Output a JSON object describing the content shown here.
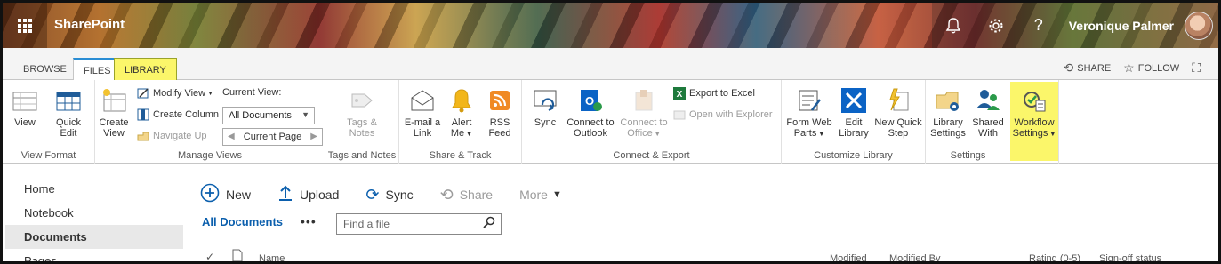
{
  "suite": {
    "app_title": "SharePoint",
    "user_name": "Veronique Palmer",
    "icons": [
      "waffle-icon",
      "bell-icon",
      "gear-icon",
      "help-icon"
    ]
  },
  "tabs": {
    "browse": "BROWSE",
    "files": "FILES",
    "library": "LIBRARY",
    "share": "SHARE",
    "follow": "FOLLOW"
  },
  "ribbon": {
    "view_format": {
      "label": "View Format",
      "view": "View",
      "quick_edit": [
        "Quick",
        "Edit"
      ]
    },
    "manage_views": {
      "label": "Manage Views",
      "create_view": [
        "Create",
        "View"
      ],
      "modify_view": "Modify View",
      "create_column": "Create Column",
      "navigate_up": "Navigate Up",
      "current_view_label": "Current View:",
      "current_view_value": "All Documents",
      "current_page": "Current Page"
    },
    "tags_notes": {
      "label": "Tags and Notes",
      "tags_notes": [
        "Tags &",
        "Notes"
      ]
    },
    "share_track": {
      "label": "Share & Track",
      "email_link": [
        "E-mail a",
        "Link"
      ],
      "alert_me": [
        "Alert",
        "Me"
      ],
      "rss_feed": [
        "RSS",
        "Feed"
      ]
    },
    "connect_export": {
      "label": "Connect & Export",
      "sync": "Sync",
      "connect_outlook": [
        "Connect to",
        "Outlook"
      ],
      "connect_office": [
        "Connect to",
        "Office"
      ],
      "export_excel": "Export to Excel",
      "open_explorer": "Open with Explorer"
    },
    "customize_library": {
      "label": "Customize Library",
      "form_web_parts": [
        "Form Web",
        "Parts"
      ],
      "edit_library": [
        "Edit",
        "Library"
      ],
      "new_quick_step": [
        "New Quick",
        "Step"
      ]
    },
    "settings": {
      "label": "Settings",
      "library_settings": [
        "Library",
        "Settings"
      ],
      "shared_with": [
        "Shared",
        "With"
      ],
      "workflow_settings": [
        "Workflow",
        "Settings"
      ]
    }
  },
  "nav": {
    "items": [
      "Home",
      "Notebook",
      "Documents",
      "Pages"
    ],
    "selected": "Documents"
  },
  "commands": {
    "new": "New",
    "upload": "Upload",
    "sync": "Sync",
    "share": "Share",
    "more": "More"
  },
  "view": {
    "name": "All Documents",
    "more": "•••",
    "search_placeholder": "Find a file"
  },
  "columns": {
    "name": "Name",
    "modified": "Modified",
    "modified_by": "Modified By",
    "rating": "Rating (0-5)",
    "signoff": "Sign-off status"
  },
  "colors": {
    "accent": "#0b5fad",
    "highlight": "#fbf66a",
    "tab_border": "#2a8dd4"
  }
}
